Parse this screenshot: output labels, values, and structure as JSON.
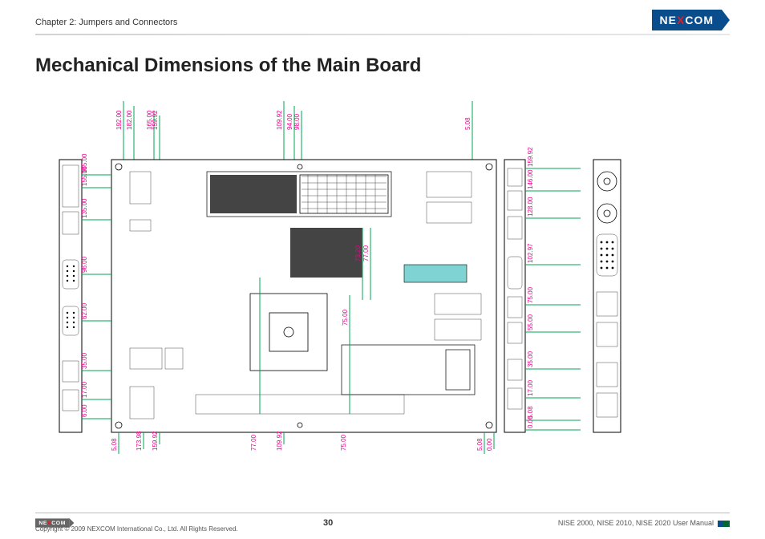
{
  "header": {
    "chapter": "Chapter 2: Jumpers and Connectors",
    "brand_pre": "NE",
    "brand_x": "X",
    "brand_post": "COM"
  },
  "title": "Mechanical Dimensions of the Main Board",
  "dim_top": [
    "192.00",
    "182.00",
    "165.00",
    "159.92",
    "109.92",
    "94.00",
    "98.00",
    "5.08"
  ],
  "dim_left": [
    "165.00",
    "155.00",
    "135.00",
    "96.00",
    "62.00",
    "35.00",
    "17.00",
    "6.00"
  ],
  "dim_right": [
    "159.92",
    "146.00",
    "128.00",
    "102.97",
    "75.00",
    "55.00",
    "35.00",
    "17.00",
    "5.08",
    "0.00"
  ],
  "dim_bot": [
    "5.08",
    "173.98",
    "159.92",
    "77.00",
    "109.92",
    "75.00",
    "5.08",
    "0.00"
  ],
  "dim_inner": [
    "73.20",
    "77.00",
    "75.00"
  ],
  "footer": {
    "copyright": "Copyright © 2009 NEXCOM International Co., Ltd. All Rights Reserved.",
    "page": "30",
    "doc": "NISE 2000, NISE 2010, NISE 2020 User Manual"
  }
}
